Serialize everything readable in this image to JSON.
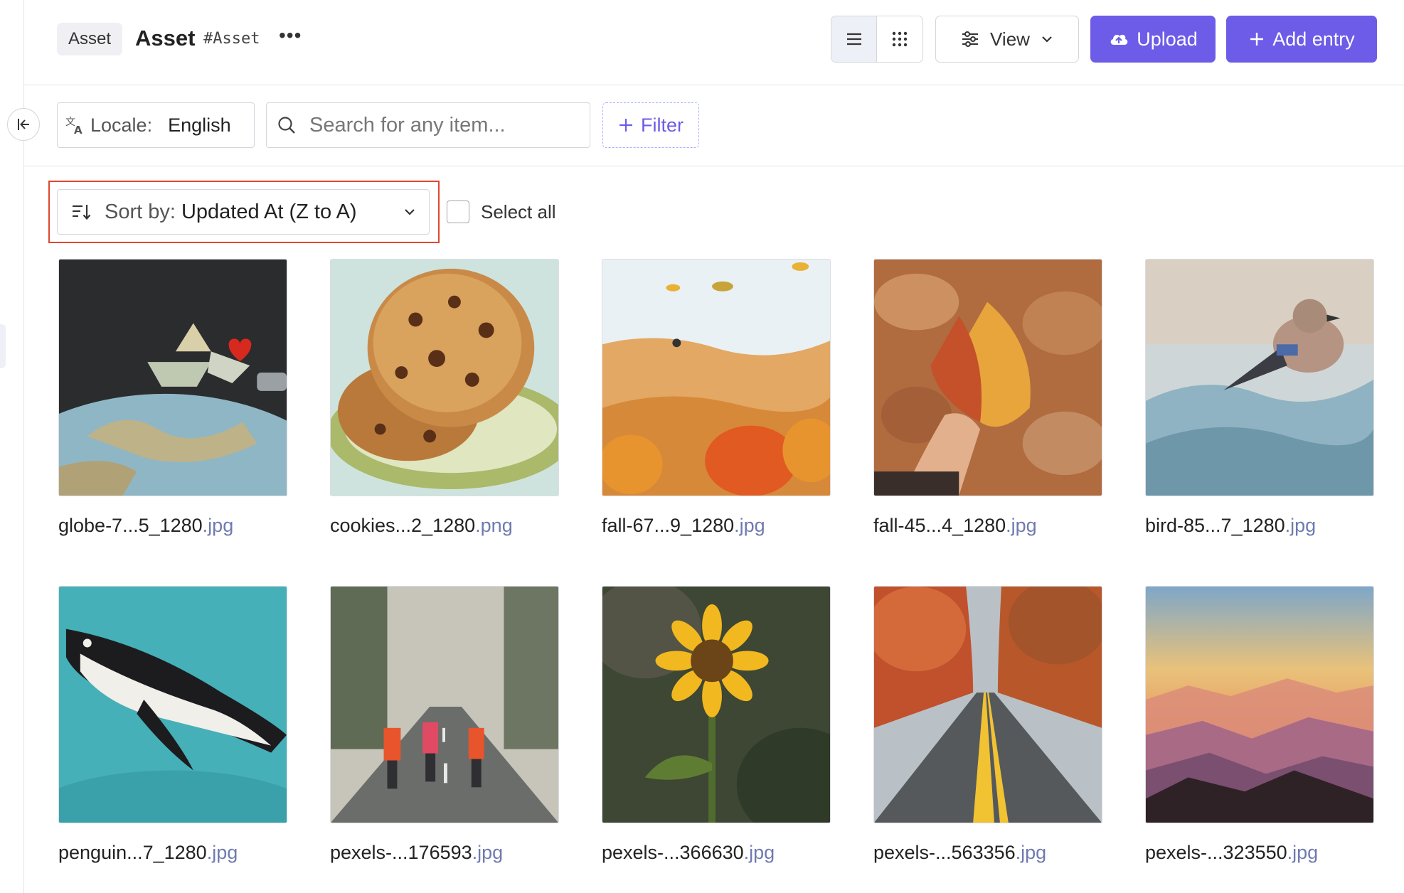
{
  "header": {
    "content_type_chip": "Asset",
    "title": "Asset",
    "uid": "#Asset",
    "more_label": "•••",
    "view_label": "View",
    "upload_label": "Upload",
    "add_entry_label": "Add entry"
  },
  "filters": {
    "locale_label": "Locale:",
    "locale_value": "English",
    "search_placeholder": "Search for any item...",
    "filter_label": "Filter"
  },
  "sort": {
    "label": "Sort by:",
    "value": "Updated At (Z to A)"
  },
  "select_all_label": "Select all",
  "assets": [
    {
      "name": "globe-7...5_1280",
      "ext": ".jpg",
      "thumb": "globe"
    },
    {
      "name": "cookies...2_1280",
      "ext": ".png",
      "thumb": "cookies"
    },
    {
      "name": "fall-67...9_1280",
      "ext": ".jpg",
      "thumb": "fall-illustration"
    },
    {
      "name": "fall-45...4_1280",
      "ext": ".jpg",
      "thumb": "fall-leaf"
    },
    {
      "name": "bird-85...7_1280",
      "ext": ".jpg",
      "thumb": "bird"
    },
    {
      "name": "penguin...7_1280",
      "ext": ".jpg",
      "thumb": "penguin"
    },
    {
      "name": "pexels-...176593",
      "ext": ".jpg",
      "thumb": "road-people"
    },
    {
      "name": "pexels-...366630",
      "ext": ".jpg",
      "thumb": "sunflower"
    },
    {
      "name": "pexels-...563356",
      "ext": ".jpg",
      "thumb": "autumn-road"
    },
    {
      "name": "pexels-...323550",
      "ext": ".jpg",
      "thumb": "mountains-sunset"
    }
  ],
  "colors": {
    "primary": "#6c5ce7",
    "highlight": "#e0472f",
    "extension_text": "#6f7ab0"
  }
}
